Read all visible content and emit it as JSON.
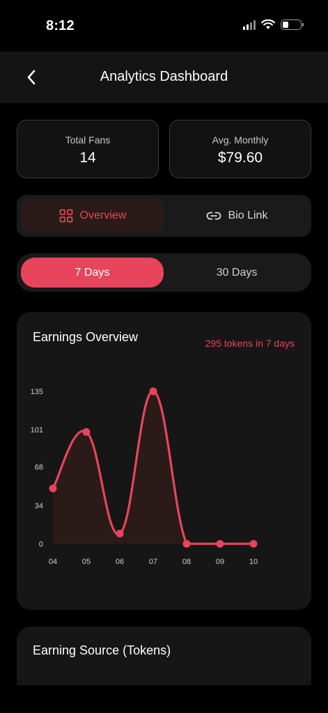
{
  "status_bar": {
    "time": "8:12"
  },
  "nav": {
    "title": "Analytics Dashboard"
  },
  "stats": {
    "fans_label": "Total Fans",
    "fans_value": "14",
    "monthly_label": "Avg. Monthly",
    "monthly_value": "$79.60"
  },
  "view_tabs": {
    "overview_label": "Overview",
    "biolink_label": "Bio Link",
    "selected": "Overview"
  },
  "range_tabs": {
    "seven_label": "7 Days",
    "thirty_label": "30 Days",
    "selected": "7 Days"
  },
  "chart": {
    "title": "Earnings Overview",
    "summary": "295 tokens in 7 days"
  },
  "chart_data": {
    "type": "area",
    "categories": [
      "04",
      "05",
      "06",
      "07",
      "08",
      "09",
      "10"
    ],
    "values": [
      49,
      99,
      9,
      135,
      0,
      0,
      0
    ],
    "y_ticks": [
      "0",
      "34",
      "68",
      "101",
      "135"
    ],
    "ylim": [
      0,
      135
    ],
    "grid": false,
    "line_color": "#e8455c",
    "fill_color": "#2a1b18"
  },
  "earning_source": {
    "title": "Earning Source (Tokens)"
  },
  "colors": {
    "accent": "#e8455c",
    "background": "#000000",
    "card": "#161616"
  }
}
